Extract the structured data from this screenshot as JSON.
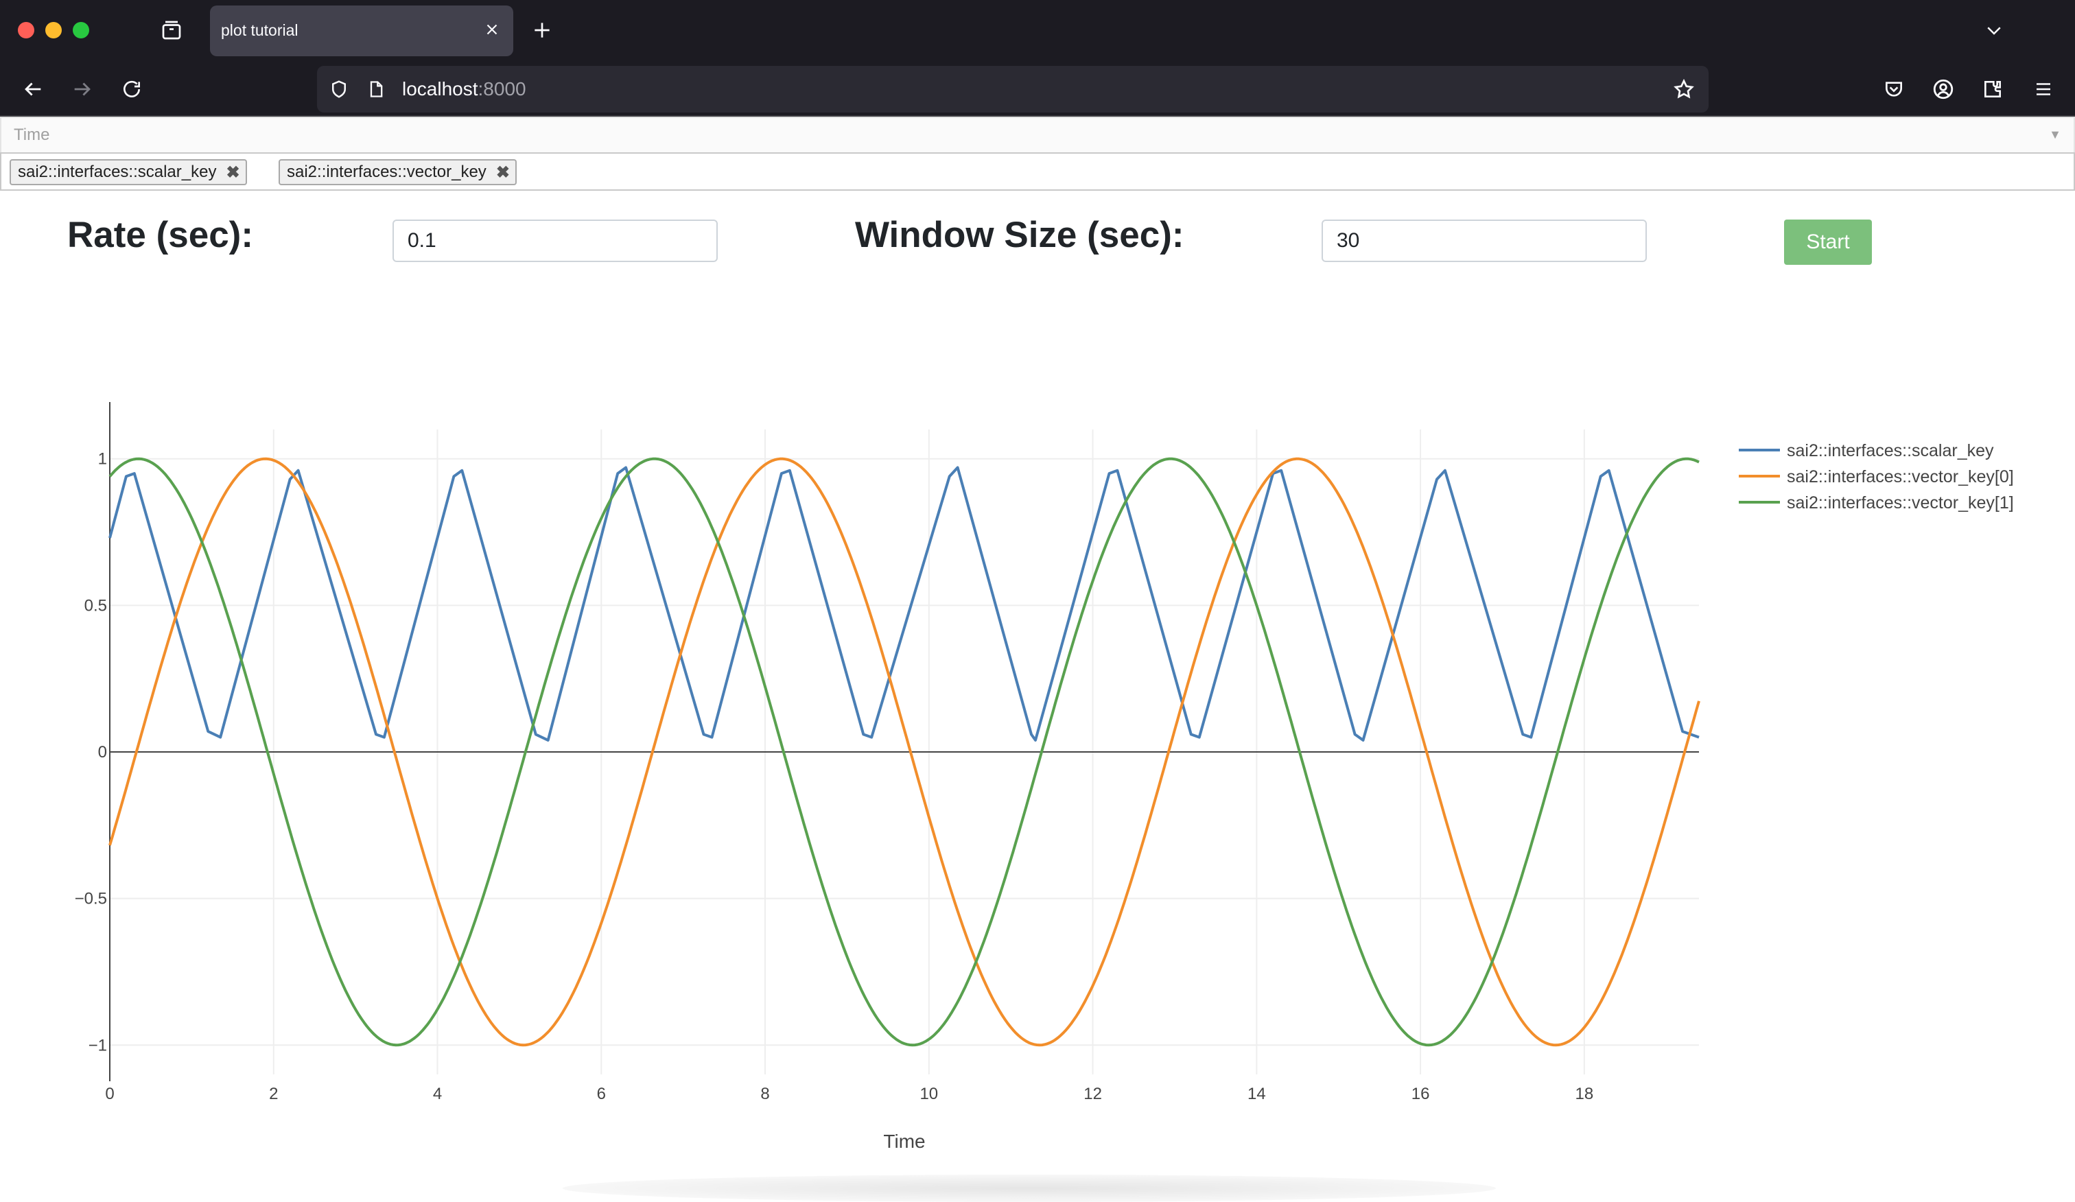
{
  "browser": {
    "tab_title": "plot tutorial",
    "url_host": "localhost",
    "url_port": ":8000"
  },
  "controls": {
    "time_placeholder": "Time",
    "keys": [
      "sai2::interfaces::scalar_key",
      "sai2::interfaces::vector_key"
    ],
    "rate_label": "Rate (sec):",
    "rate_value": "0.1",
    "window_label": "Window Size (sec):",
    "window_value": "30",
    "start_label": "Start"
  },
  "chart_data": {
    "type": "line",
    "xlabel": "Time",
    "ylabel": "",
    "xlim": [
      0,
      19.4
    ],
    "ylim": [
      -1.1,
      1.1
    ],
    "xticks": [
      0,
      2,
      4,
      6,
      8,
      10,
      12,
      14,
      16,
      18
    ],
    "yticks": [
      -1,
      -0.5,
      0,
      0.5,
      1
    ],
    "ytick_labels": [
      "−1",
      "−0.5",
      "0",
      "0.5",
      "1"
    ],
    "legend_position": "top-right",
    "grid": true,
    "series": [
      {
        "name": "sai2::interfaces::scalar_key",
        "color": "#4a7fb5",
        "x": [
          0,
          0.2,
          0.3,
          1.2,
          1.35,
          2.2,
          2.3,
          3.25,
          3.35,
          4.2,
          4.3,
          5.2,
          5.35,
          6.2,
          6.3,
          7.25,
          7.35,
          8.2,
          8.3,
          9.2,
          9.3,
          10.25,
          10.35,
          11.25,
          11.3,
          12.2,
          12.3,
          13.2,
          13.3,
          14.2,
          14.3,
          15.2,
          15.3,
          16.2,
          16.3,
          17.25,
          17.35,
          18.2,
          18.3,
          19.2,
          19.4
        ],
        "y": [
          0.73,
          0.94,
          0.95,
          0.07,
          0.05,
          0.93,
          0.96,
          0.06,
          0.05,
          0.94,
          0.96,
          0.06,
          0.04,
          0.95,
          0.97,
          0.06,
          0.05,
          0.95,
          0.96,
          0.06,
          0.05,
          0.94,
          0.97,
          0.06,
          0.04,
          0.95,
          0.96,
          0.06,
          0.05,
          0.95,
          0.96,
          0.06,
          0.04,
          0.93,
          0.96,
          0.06,
          0.05,
          0.94,
          0.96,
          0.07,
          0.05
        ]
      },
      {
        "name": "sai2::interfaces::vector_key[0]",
        "color": "#f28e2b",
        "amplitude": 1,
        "period": 6.3,
        "phase_x": 1.9,
        "x_start": 0,
        "x_end": 19.4
      },
      {
        "name": "sai2::interfaces::vector_key[1]",
        "color": "#59a14f",
        "amplitude": 1,
        "period": 6.3,
        "phase_x": 0.35,
        "x_start": 0,
        "x_end": 19.4
      }
    ]
  }
}
